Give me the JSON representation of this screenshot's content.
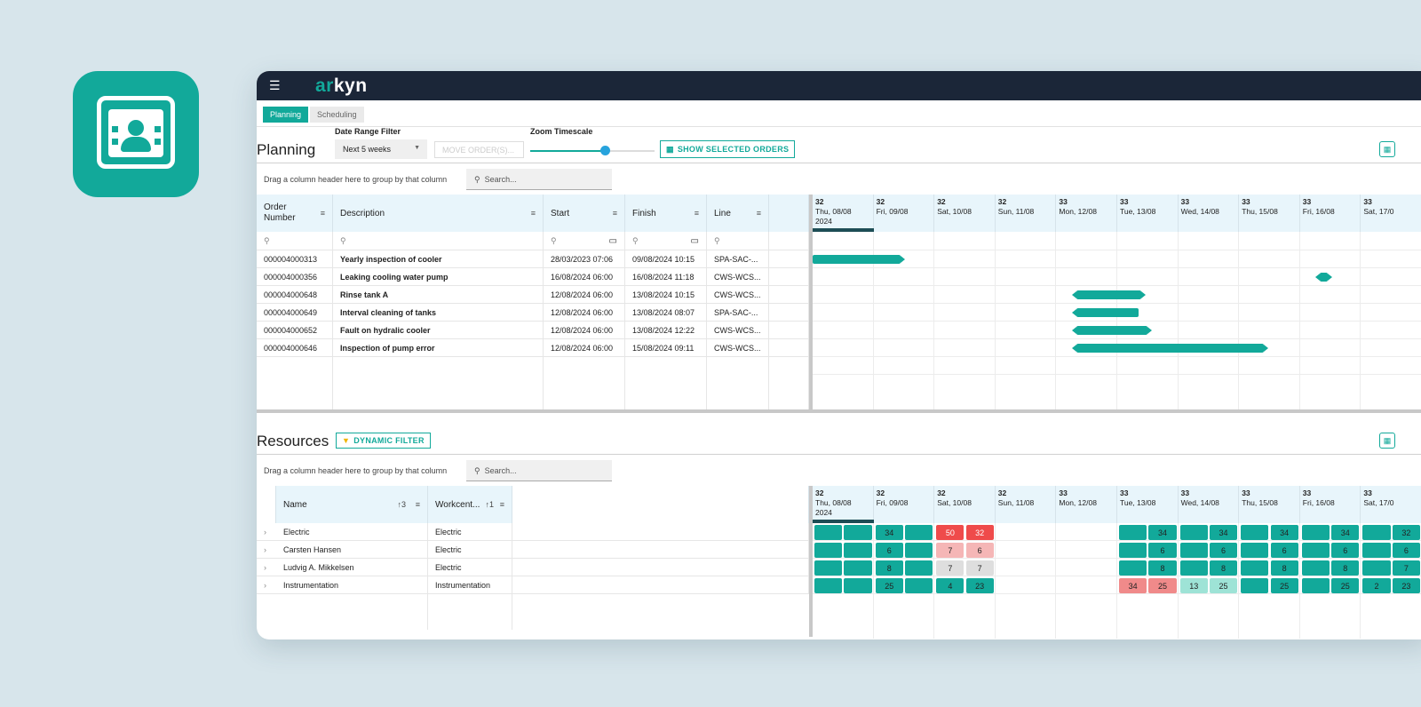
{
  "brand": {
    "logo_prefix": "ar",
    "logo_suffix": "kyn",
    "accent": "#12a99a",
    "topbar": "#1b2638"
  },
  "icons": {
    "menu": "hamburger-icon",
    "app": "person-board-icon",
    "search": "search-icon",
    "calendar": "calendar-icon",
    "filter": "funnel-icon",
    "expand": "chevron-right-icon"
  },
  "tabs": [
    {
      "label": "Planning",
      "active": true
    },
    {
      "label": "Scheduling",
      "active": false
    }
  ],
  "planning": {
    "title": "Planning",
    "date_range_label": "Date Range Filter",
    "date_range_value": "Next 5 weeks",
    "move_orders_label": "MOVE ORDER(S)...",
    "zoom_label": "Zoom Timescale",
    "zoom_level": 0.6,
    "show_selected_label": "SHOW SELECTED ORDERS",
    "drag_hint": "Drag a column header here to group by that column",
    "search_placeholder": "Search...",
    "columns": [
      "Order Number",
      "Description",
      "Start",
      "Finish",
      "Line"
    ],
    "orders": [
      {
        "order": "000004000313",
        "description": "Yearly inspection of cooler",
        "start": "28/03/2023 07:06",
        "finish": "09/08/2024 10:15",
        "line": "SPA-SAC-..."
      },
      {
        "order": "000004000356",
        "description": "Leaking cooling water pump",
        "start": "16/08/2024 06:00",
        "finish": "16/08/2024 11:18",
        "line": "CWS-WCS..."
      },
      {
        "order": "000004000648",
        "description": "Rinse tank A",
        "start": "12/08/2024 06:00",
        "finish": "13/08/2024 10:15",
        "line": "CWS-WCS..."
      },
      {
        "order": "000004000649",
        "description": "Interval cleaning of tanks",
        "start": "12/08/2024 06:00",
        "finish": "13/08/2024 08:07",
        "line": "SPA-SAC-..."
      },
      {
        "order": "000004000652",
        "description": "Fault on hydralic cooler",
        "start": "12/08/2024 06:00",
        "finish": "13/08/2024 12:22",
        "line": "CWS-WCS..."
      },
      {
        "order": "000004000646",
        "description": "Inspection of pump error",
        "start": "12/08/2024 06:00",
        "finish": "15/08/2024 09:11",
        "line": "CWS-WCS..."
      }
    ]
  },
  "timeline": {
    "days": [
      {
        "week": "32",
        "date": "Thu, 08/08",
        "year": "2024"
      },
      {
        "week": "32",
        "date": "Fri, 09/08",
        "year": ""
      },
      {
        "week": "32",
        "date": "Sat, 10/08",
        "year": ""
      },
      {
        "week": "32",
        "date": "Sun, 11/08",
        "year": ""
      },
      {
        "week": "33",
        "date": "Mon, 12/08",
        "year": ""
      },
      {
        "week": "33",
        "date": "Tue, 13/08",
        "year": ""
      },
      {
        "week": "33",
        "date": "Wed, 14/08",
        "year": ""
      },
      {
        "week": "33",
        "date": "Thu, 15/08",
        "year": ""
      },
      {
        "week": "33",
        "date": "Fri, 16/08",
        "year": ""
      },
      {
        "week": "33",
        "date": "Sat, 17/0",
        "year": ""
      }
    ],
    "bars": [
      {
        "start": 0,
        "end": 1.45,
        "left_tip": false,
        "right_tip": true
      },
      {
        "start": 8.25,
        "end": 8.45,
        "left_tip": true,
        "right_tip": true
      },
      {
        "start": 4.25,
        "end": 5.4,
        "left_tip": true,
        "right_tip": true
      },
      {
        "start": 4.25,
        "end": 5.35,
        "left_tip": true,
        "right_tip": false
      },
      {
        "start": 4.25,
        "end": 5.5,
        "left_tip": true,
        "right_tip": true
      },
      {
        "start": 4.25,
        "end": 7.4,
        "left_tip": true,
        "right_tip": true
      }
    ]
  },
  "resources": {
    "title": "Resources",
    "dynamic_filter_label": "DYNAMIC FILTER",
    "drag_hint": "Drag a column header here to group by that column",
    "search_placeholder": "Search...",
    "col_name": "Name",
    "col_name_sort": "↑3",
    "col_workcenter": "Workcent...",
    "col_workcenter_sort": "↑1",
    "rows": [
      {
        "name": "Electric",
        "workcenter": "Electric",
        "cells": [
          [
            "green",
            "",
            ""
          ],
          [
            "green",
            "34",
            ""
          ],
          [
            "red",
            "50",
            "32"
          ],
          null,
          null,
          [
            "green",
            "",
            "34"
          ],
          [
            "green",
            "",
            "34"
          ],
          [
            "green",
            "",
            "34"
          ],
          [
            "green",
            "",
            "34"
          ],
          [
            "green",
            "",
            "32"
          ]
        ]
      },
      {
        "name": "Carsten Hansen",
        "workcenter": "Electric",
        "cells": [
          [
            "green",
            "",
            ""
          ],
          [
            "green",
            "6",
            ""
          ],
          [
            "pink",
            "7",
            "6"
          ],
          null,
          null,
          [
            "green",
            "",
            "6"
          ],
          [
            "green",
            "",
            "6"
          ],
          [
            "green",
            "",
            "6"
          ],
          [
            "green",
            "",
            "6"
          ],
          [
            "green",
            "",
            "6"
          ]
        ]
      },
      {
        "name": "Ludvig A. Mikkelsen",
        "workcenter": "Electric",
        "cells": [
          [
            "green",
            "",
            ""
          ],
          [
            "green",
            "8",
            ""
          ],
          [
            "grey",
            "7",
            "7"
          ],
          null,
          null,
          [
            "green",
            "",
            "8"
          ],
          [
            "green",
            "",
            "8"
          ],
          [
            "green",
            "",
            "8"
          ],
          [
            "green",
            "",
            "8"
          ],
          [
            "green",
            "",
            "7"
          ]
        ]
      },
      {
        "name": "Instrumentation",
        "workcenter": "Instrumentation",
        "cells": [
          [
            "green",
            "",
            ""
          ],
          [
            "green",
            "25",
            ""
          ],
          [
            "green",
            "4",
            "23"
          ],
          null,
          null,
          [
            "salmon",
            "34",
            "25"
          ],
          [
            "mint",
            "13",
            "25"
          ],
          [
            "green",
            "",
            "25"
          ],
          [
            "green",
            "",
            "25"
          ],
          [
            "green",
            "2",
            "23"
          ]
        ]
      }
    ]
  }
}
